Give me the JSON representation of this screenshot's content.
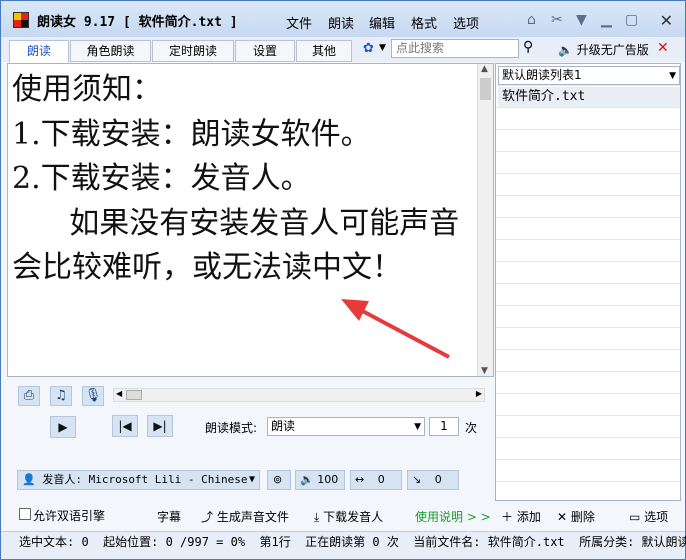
{
  "titlebar": {
    "app_title": "朗读女 9.17 [ 软件简介.txt ]",
    "menus": [
      "文件",
      "朗读",
      "编辑",
      "格式",
      "选项"
    ]
  },
  "tabs": [
    "朗读",
    "角色朗读",
    "定时朗读",
    "设置",
    "其他"
  ],
  "search": {
    "placeholder": "点此搜索"
  },
  "upgrade_label": "升级无广告版",
  "document": {
    "text": "使用须知：\n1.下载安装：朗读女软件。\n2.下载安装：发音人。\n      如果没有安装发音人可能声音会比较难听，或无法读中文！"
  },
  "playlist": {
    "selected": "默认朗读列表1",
    "items": [
      "软件简介.txt"
    ],
    "add_label": "添加",
    "delete_label": "删除",
    "options_label": "选项"
  },
  "controls": {
    "mode_label": "朗读模式:",
    "mode_value": "朗读",
    "repeat_value": "1",
    "repeat_unit": "次",
    "voice_label": "发音人:",
    "voice_value": "Microsoft Lili - Chinese",
    "volume": "100",
    "speed": "0",
    "pitch": "0",
    "bilingual_label": "允许双语引擎",
    "subtitle_label": "字幕",
    "gen_audio_label": "生成声音文件",
    "download_voice_label": "下载发音人",
    "help_label": "使用说明 > >"
  },
  "status": {
    "text": "选中文本: 0  起始位置: 0 /997 = 0%  第1行  正在朗读第 0 次  当前文件名: 软件简介.txt  所属分类: 默认朗读列"
  },
  "colors": {
    "accent": "#1a56c4",
    "help_green": "#1a9c2e",
    "annotation_red": "#e53b3b"
  }
}
